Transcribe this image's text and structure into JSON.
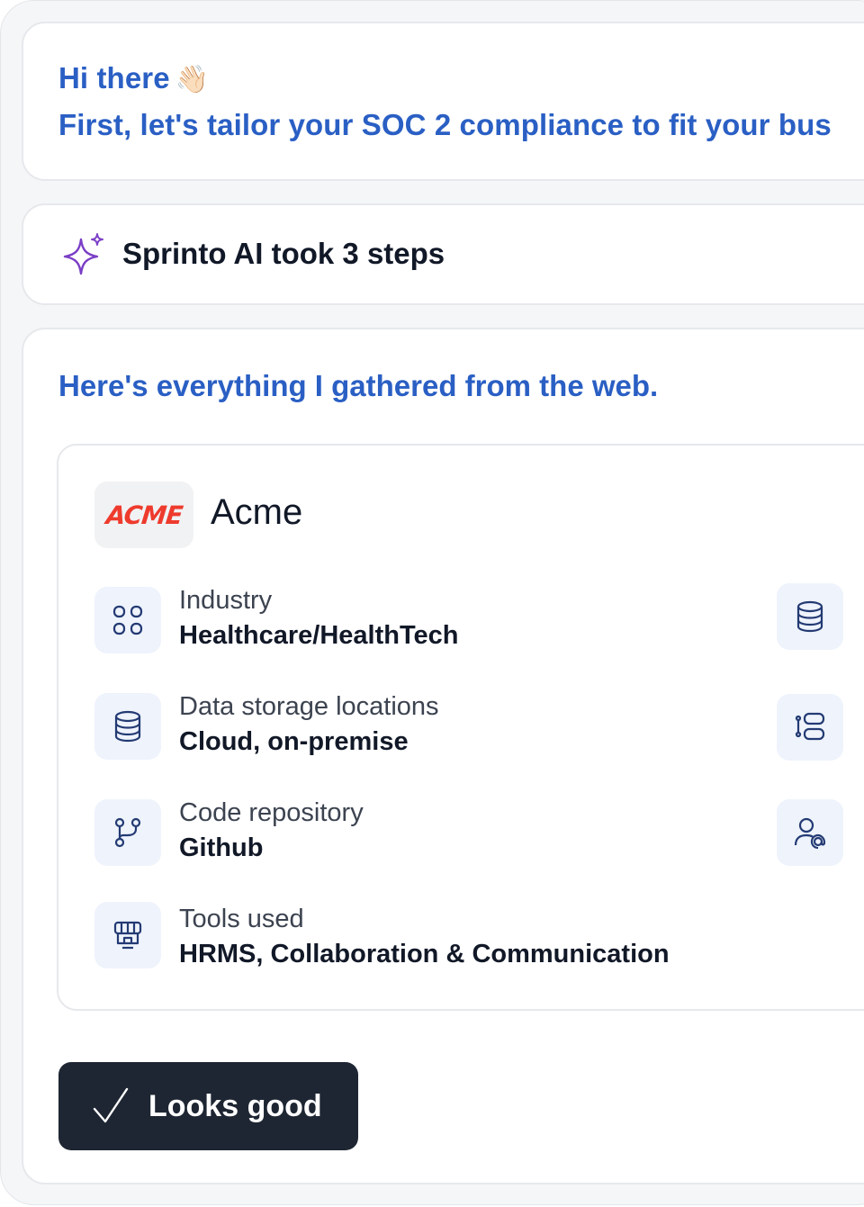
{
  "greeting": {
    "line1": "Hi there",
    "emoji": "👋🏻",
    "line2": "First, let's tailor your SOC 2 compliance to fit your bus"
  },
  "ai_steps": {
    "text": "Sprinto AI took 3 steps",
    "icon": "sparkle-icon"
  },
  "summary": {
    "heading": "Here's everything I gathered from the web.",
    "company": {
      "logo_text": "ACME",
      "name": "Acme"
    },
    "fields": [
      {
        "label": "Industry",
        "value": "Healthcare/HealthTech",
        "icon": "grid-icon"
      },
      {
        "label": "Data storage locations",
        "value": "Cloud, on-premise",
        "icon": "database-icon"
      },
      {
        "label": "Code repository",
        "value": "Github",
        "icon": "git-branch-icon"
      },
      {
        "label": "Tools used",
        "value": "HRMS, Collaboration & Communication",
        "icon": "storefront-icon"
      }
    ],
    "right_icons": [
      "database-icon",
      "server-list-icon",
      "user-at-icon"
    ]
  },
  "actions": {
    "confirm_label": "Looks good",
    "confirm_icon": "checkmark-icon"
  },
  "colors": {
    "accent": "#2a5fc4",
    "button_bg": "#1e2633",
    "icon_bg": "#eef3fc",
    "icon_stroke": "#233a73",
    "sparkle": "#7b3fc6",
    "logo_red": "#ee3b2d"
  }
}
